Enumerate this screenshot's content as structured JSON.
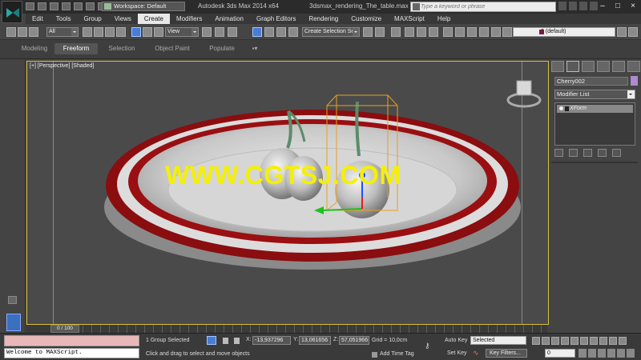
{
  "window": {
    "workspace": "Workspace: Default",
    "app_title": "Autodesk 3ds Max  2014 x64",
    "file_title": "3dsmax_rendering_The_table.max",
    "search_placeholder": "Type a keyword or phrase"
  },
  "menu": [
    "Edit",
    "Tools",
    "Group",
    "Views",
    "Create",
    "Modifiers",
    "Animation",
    "Graph Editors",
    "Rendering",
    "Customize",
    "MAXScript",
    "Help"
  ],
  "menu_active": "Create",
  "toolbar": {
    "filter_value": "All",
    "coord_system": "View",
    "selection_set": "Create Selection Se",
    "layer": "0 (default)"
  },
  "ribbon": {
    "tabs": [
      "Modeling",
      "Freeform",
      "Selection",
      "Object Paint",
      "Populate"
    ],
    "active": "Freeform"
  },
  "viewport": {
    "label": "[+] [Perspective] [Shaded]",
    "watermark": "WWW.CGTSJ.COM"
  },
  "command_panel": {
    "object_name": "Cherry002",
    "object_color": "#b08ad0",
    "modifier_list_label": "Modifier List",
    "stack_items": [
      "XForm"
    ]
  },
  "timeline": {
    "frame_display": "0 / 100"
  },
  "status": {
    "script_output": "Welcome to MAXScript.",
    "selection_info": "1 Group Selected",
    "prompt": "Click and drag to select and move objects",
    "x_label": "X:",
    "x_value": "-13,937296",
    "y_label": "Y:",
    "y_value": "13,061656",
    "z_label": "Z:",
    "z_value": "57,051966",
    "grid": "Grid = 10,0cm",
    "add_time_tag": "Add Time Tag",
    "auto_key": "Auto Key",
    "set_key": "Set Key",
    "key_mode": "Selected",
    "key_filters": "Key Filters...",
    "current_frame": "0"
  }
}
